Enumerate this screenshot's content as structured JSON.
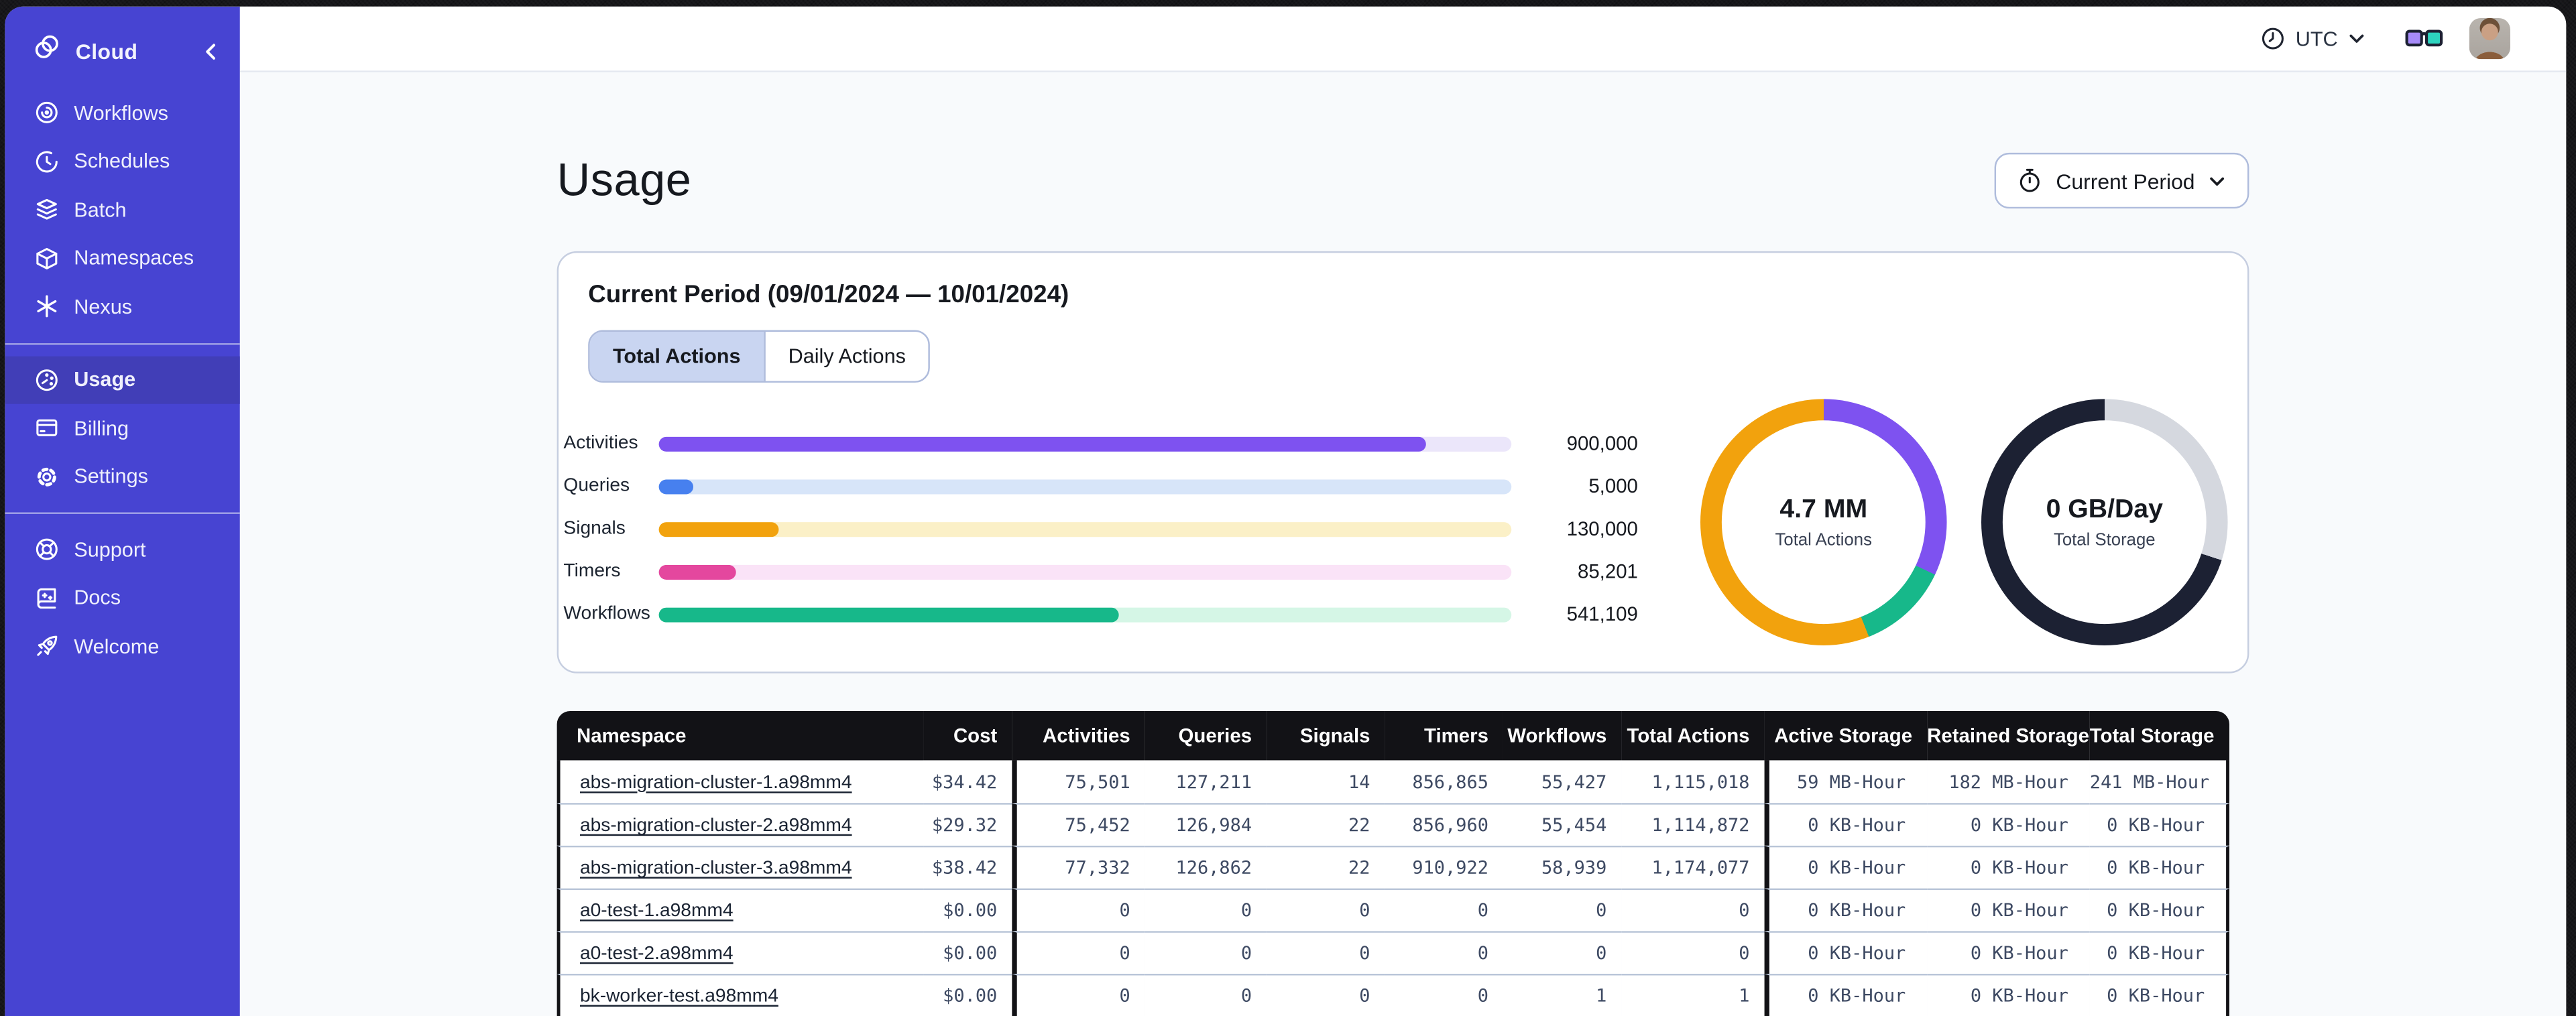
{
  "sidebar": {
    "brand": {
      "label": "Cloud"
    },
    "nav_main": [
      {
        "label": "Workflows"
      },
      {
        "label": "Schedules"
      },
      {
        "label": "Batch"
      },
      {
        "label": "Namespaces"
      },
      {
        "label": "Nexus"
      }
    ],
    "nav_account": [
      {
        "label": "Usage",
        "active": true
      },
      {
        "label": "Billing"
      },
      {
        "label": "Settings"
      }
    ],
    "nav_support": [
      {
        "label": "Support"
      },
      {
        "label": "Docs"
      },
      {
        "label": "Welcome"
      }
    ],
    "colors": {
      "background": "#4744D2",
      "active_item": "#413EB7"
    }
  },
  "topbar": {
    "timezone": "UTC"
  },
  "page": {
    "title": "Usage",
    "period_button": {
      "label": "Current Period"
    }
  },
  "usage_card": {
    "title": "Current Period (09/01/2024 — 10/01/2024)",
    "tabs": [
      {
        "label": "Total Actions",
        "active": true
      },
      {
        "label": "Daily Actions",
        "active": false
      }
    ]
  },
  "chart_data": [
    {
      "type": "bar",
      "categories": [
        "Activities",
        "Queries",
        "Signals",
        "Timers",
        "Workflows"
      ],
      "values": [
        900000,
        5000,
        130000,
        85201,
        541109
      ],
      "value_labels": [
        "900,000",
        "5,000",
        "130,000",
        "85,201",
        "541,109"
      ],
      "xlim": [
        0,
        1000000
      ],
      "fill_pct": [
        90,
        4,
        14,
        9,
        54
      ],
      "bar_colors": [
        "#7E52F0",
        "#4780EF",
        "#F2A20D",
        "#E4479E",
        "#17B88A"
      ],
      "track_colors": [
        "#EBE6FA",
        "#D7E5F9",
        "#FBF0C7",
        "#FAE3F7",
        "#D5F6E6"
      ]
    },
    {
      "type": "pie",
      "title": "4.7 MM",
      "subtitle": "Total Actions",
      "slices": [
        {
          "pct": 32,
          "color": "#7E52F0"
        },
        {
          "pct": 12,
          "color": "#17B88A"
        },
        {
          "pct": 56,
          "color": "#F2A20D"
        }
      ]
    },
    {
      "type": "pie",
      "title": "0 GB/Day",
      "subtitle": "Total Storage",
      "slices": [
        {
          "pct": 30,
          "color": "#D5D8DF"
        },
        {
          "pct": 70,
          "color": "#1C2133"
        }
      ]
    }
  ],
  "table": {
    "columns": [
      {
        "label": "Namespace",
        "key": "name",
        "type": "link"
      },
      {
        "label": "Cost",
        "key": "cost"
      },
      {
        "label": "Activities",
        "key": "activities",
        "group_start": true
      },
      {
        "label": "Queries",
        "key": "queries"
      },
      {
        "label": "Signals",
        "key": "signals"
      },
      {
        "label": "Timers",
        "key": "timers"
      },
      {
        "label": "Workflows",
        "key": "workflows"
      },
      {
        "label": "Total Actions",
        "key": "total_actions"
      },
      {
        "label": "Active Storage",
        "key": "active_storage",
        "group_start": true
      },
      {
        "label": "Retained Storage",
        "key": "retained_storage"
      },
      {
        "label": "Total Storage",
        "key": "total_storage"
      }
    ],
    "rows": [
      {
        "name": "abs-migration-cluster-1.a98mm4",
        "cost": "$34.42",
        "activities": "75,501",
        "queries": "127,211",
        "signals": "14",
        "timers": "856,865",
        "workflows": "55,427",
        "total_actions": "1,115,018",
        "active_storage": "59 MB-Hour",
        "retained_storage": "182 MB-Hour",
        "total_storage": "241 MB-Hour"
      },
      {
        "name": "abs-migration-cluster-2.a98mm4",
        "cost": "$29.32",
        "activities": "75,452",
        "queries": "126,984",
        "signals": "22",
        "timers": "856,960",
        "workflows": "55,454",
        "total_actions": "1,114,872",
        "active_storage": "0 KB-Hour",
        "retained_storage": "0 KB-Hour",
        "total_storage": "0 KB-Hour"
      },
      {
        "name": "abs-migration-cluster-3.a98mm4",
        "cost": "$38.42",
        "activities": "77,332",
        "queries": "126,862",
        "signals": "22",
        "timers": "910,922",
        "workflows": "58,939",
        "total_actions": "1,174,077",
        "active_storage": "0 KB-Hour",
        "retained_storage": "0 KB-Hour",
        "total_storage": "0 KB-Hour"
      },
      {
        "name": "a0-test-1.a98mm4",
        "cost": "$0.00",
        "activities": "0",
        "queries": "0",
        "signals": "0",
        "timers": "0",
        "workflows": "0",
        "total_actions": "0",
        "active_storage": "0 KB-Hour",
        "retained_storage": "0 KB-Hour",
        "total_storage": "0 KB-Hour"
      },
      {
        "name": "a0-test-2.a98mm4",
        "cost": "$0.00",
        "activities": "0",
        "queries": "0",
        "signals": "0",
        "timers": "0",
        "workflows": "0",
        "total_actions": "0",
        "active_storage": "0 KB-Hour",
        "retained_storage": "0 KB-Hour",
        "total_storage": "0 KB-Hour"
      },
      {
        "name": "bk-worker-test.a98mm4",
        "cost": "$0.00",
        "activities": "0",
        "queries": "0",
        "signals": "0",
        "timers": "0",
        "workflows": "1",
        "total_actions": "1",
        "active_storage": "0 KB-Hour",
        "retained_storage": "0 KB-Hour",
        "total_storage": "0 KB-Hour"
      }
    ]
  }
}
